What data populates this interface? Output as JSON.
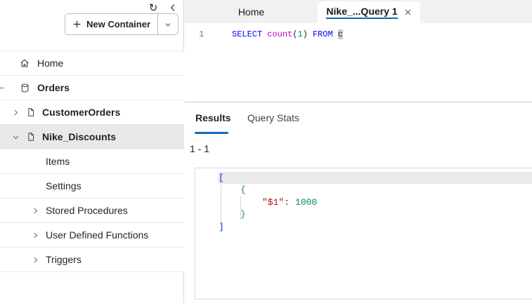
{
  "sidebar": {
    "icons": {
      "refresh": "↻"
    },
    "new_container_button": {
      "label": "New Container"
    },
    "tree": [
      {
        "label": "Home",
        "icon": "home-icon"
      },
      {
        "label": "Orders",
        "icon": "container-icon",
        "bold": true
      },
      {
        "label": "CustomerOrders",
        "icon": "document-icon",
        "chevron": "right",
        "bold": true
      },
      {
        "label": "Nike_Discounts",
        "icon": "document-icon",
        "chevron": "down",
        "bold": true,
        "selected": true
      },
      {
        "label": "Items"
      },
      {
        "label": "Settings"
      },
      {
        "label": "Stored Procedures",
        "chevron": "right"
      },
      {
        "label": "User Defined Functions",
        "chevron": "right"
      },
      {
        "label": "Triggers",
        "chevron": "right"
      }
    ]
  },
  "tabbar": {
    "home_tab": "Home",
    "query_tab": "Nike_...Query 1"
  },
  "editor": {
    "line_number": "1",
    "query": {
      "select": "SELECT",
      "count_fn": "count",
      "paren_open": "(",
      "arg": "1",
      "paren_close": ")",
      "from": "FROM",
      "alias": "c"
    }
  },
  "results": {
    "tabs": {
      "results": "Results",
      "query_stats": "Query Stats"
    },
    "range": "1 - 1",
    "json_view": {
      "bracket_open": "[",
      "brace_open": "{",
      "key": "\"$1\"",
      "colon": ":",
      "value": "1000",
      "brace_close": "}",
      "bracket_close": "]"
    }
  },
  "colors": {
    "accent_blue": "#0f6cbd",
    "tab_underline_blue": "#1168a7",
    "sql_keyword": "#0000ff",
    "sql_function": "#c700c7",
    "sql_number": "#098658",
    "json_bracket": "#0431fa",
    "json_brace": "#319331",
    "json_key": "#a31515",
    "json_number": "#098658",
    "selected_row_bg": "#e9e9e9",
    "tabbar_bg": "#f1f1f1"
  }
}
